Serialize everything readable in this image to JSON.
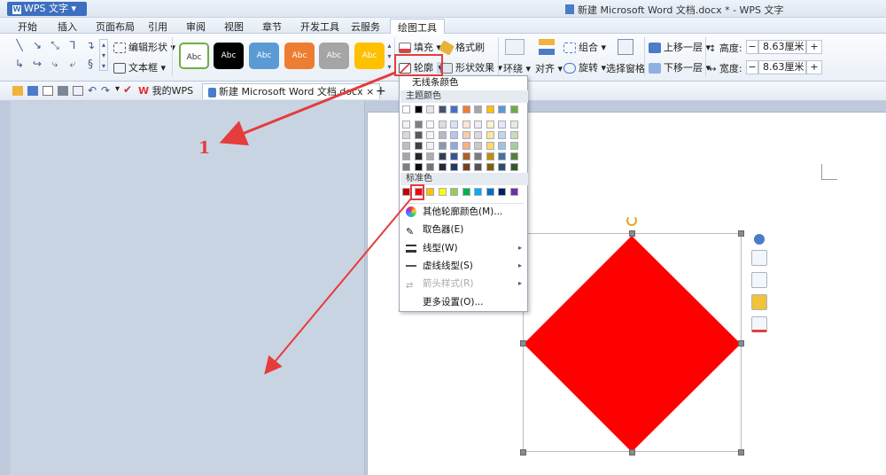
{
  "app": {
    "name": "WPS 文字",
    "window_title": "新建 Microsoft Word 文档.docx * - WPS 文字"
  },
  "menu": {
    "items": [
      "开始",
      "插入",
      "页面布局",
      "引用",
      "审阅",
      "视图",
      "章节",
      "开发工具",
      "云服务",
      "绘图工具"
    ],
    "active": "绘图工具"
  },
  "ribbon": {
    "edit_shape": "编辑形状",
    "text_box": "文本框",
    "style_label": "Abc",
    "fill": "填充",
    "format_brush": "格式刷",
    "outline": "轮廓",
    "shape_effect": "形状效果",
    "wrap": "环绕",
    "align": "对齐",
    "group": "组合",
    "rotate": "旋转",
    "selection_pane": "选择窗格",
    "bring_forward": "上移一层",
    "send_backward": "下移一层",
    "height_label": "高度:",
    "height_value": "8.63厘米",
    "width_label": "宽度:",
    "width_value": "8.63厘米",
    "minus": "−",
    "plus": "+"
  },
  "tabs": {
    "my_wps": "我的WPS",
    "doc": "新建 Microsoft Word 文档.docx",
    "doc_close": "×",
    "add": "+"
  },
  "dropdown": {
    "no_line": "无线条颜色",
    "theme_header": "主题颜色",
    "standard_header": "标准色",
    "more_colors": "其他轮廓颜色(M)...",
    "eyedropper": "取色器(E)",
    "line_type": "线型(W)",
    "dash_type": "虚线线型(S)",
    "arrow_style": "箭头样式(R)",
    "more_settings": "更多设置(O)..."
  },
  "annotation": {
    "step": "1"
  },
  "colors": {
    "accent": "#3c6fbf",
    "shape_fill": "#ff0000",
    "annotation": "#e53c3c",
    "style_swatches": [
      "#ffffff",
      "#000000",
      "#5b9bd5",
      "#ed7d31",
      "#a5a5a5",
      "#ffc000"
    ],
    "theme_top": [
      "#ffffff",
      "#000000",
      "#e7e6e6",
      "#44546a",
      "#4472c4",
      "#ed7d31",
      "#a5a5a5",
      "#ffc000",
      "#5b9bd5",
      "#70ad47"
    ],
    "standard": [
      "#c00000",
      "#ff0000",
      "#ffc000",
      "#ffff00",
      "#92d050",
      "#00b050",
      "#00b0f0",
      "#0070c0",
      "#002060",
      "#7030a0"
    ]
  }
}
